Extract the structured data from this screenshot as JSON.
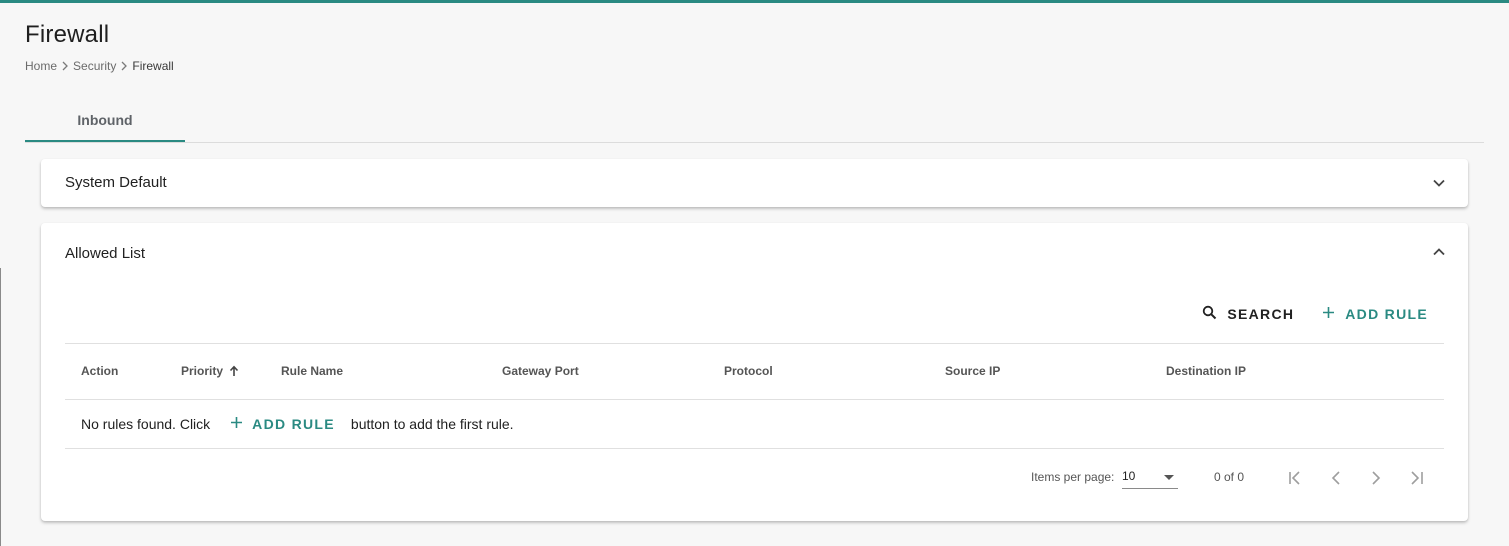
{
  "page": {
    "title": "Firewall",
    "breadcrumb": [
      "Home",
      "Security",
      "Firewall"
    ]
  },
  "tabs": [
    {
      "label": "Inbound",
      "active": true
    }
  ],
  "panels": {
    "system_default": {
      "title": "System Default",
      "expanded": false
    },
    "allowed_list": {
      "title": "Allowed List",
      "expanded": true,
      "toolbar": {
        "search_label": "SEARCH",
        "add_label": "ADD RULE"
      },
      "columns": [
        "Action",
        "Priority",
        "Rule Name",
        "Gateway Port",
        "Protocol",
        "Source IP",
        "Destination IP"
      ],
      "sort": {
        "column": "Priority",
        "direction": "ascending"
      },
      "empty": {
        "prefix": "No rules found. Click",
        "button": "ADD RULE",
        "suffix": "button to add the first rule."
      },
      "paginator": {
        "items_per_page_label": "Items per page:",
        "page_size": "10",
        "range": "0 of 0"
      }
    }
  },
  "colors": {
    "accent": "#2a8a82",
    "background": "#f7f7f7",
    "text": "#212121"
  }
}
